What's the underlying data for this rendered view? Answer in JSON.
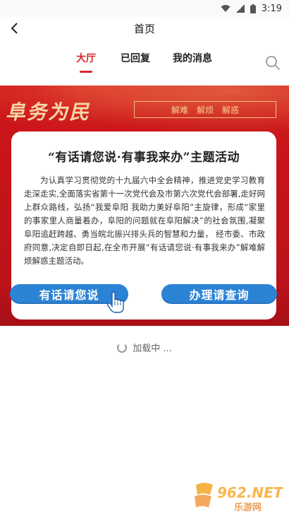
{
  "status_bar": {
    "time": "3:19"
  },
  "header": {
    "title": "首页"
  },
  "tabs": [
    {
      "label": "大厅",
      "active": true
    },
    {
      "label": "已回复",
      "active": false
    },
    {
      "label": "我的消息",
      "active": false
    }
  ],
  "banner": {
    "brand": "阜务为民",
    "tags": [
      "解难",
      "解烦",
      "解惑"
    ]
  },
  "card": {
    "title": "“有话请您说·有事我来办”主题活动",
    "body": "为认真学习贯彻党的十九届六中全会精神，推进党史学习教育走深走实,全面落实省第十一次党代会及市第六次党代会部署,走好网上群众路线，弘扬“我爱阜阳 我助力美好阜阳”主旋律，形成“家里的事家里人商量着办，阜阳的问题就在阜阳解决”的社会氛围,凝聚阜阳追赶跨越、勇当皖北振兴排头兵的智慧和力量， 经市委、市政府同意,决定自即日起,在全市开展“有话请您说·有事我来办”解难解烦解惑主题活动。"
  },
  "buttons": {
    "talk": "有话请您说",
    "query": "办理请查询"
  },
  "loading": {
    "text": "加载中 ..."
  },
  "watermark": {
    "brand": "962.NET",
    "sub": "乐游网"
  },
  "colors": {
    "accent": "#d8262c",
    "button": "#2b83d6",
    "banner": "#c4141a"
  }
}
